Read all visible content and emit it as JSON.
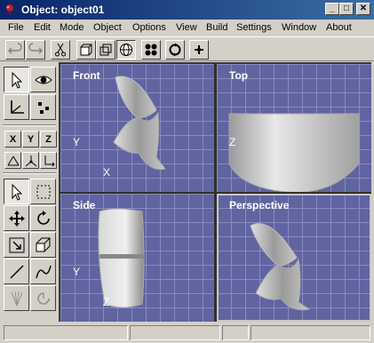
{
  "window": {
    "title": "Object: object01",
    "min_glyph": "_",
    "max_glyph": "□",
    "close_glyph": "✕"
  },
  "menu": [
    {
      "label": "File"
    },
    {
      "label": "Edit"
    },
    {
      "label": "Mode"
    },
    {
      "label": "Object"
    },
    {
      "label": "Options"
    },
    {
      "label": "View"
    },
    {
      "label": "Build"
    },
    {
      "label": "Settings"
    },
    {
      "label": "Window"
    },
    {
      "label": "About"
    }
  ],
  "toolbar": {
    "icons": [
      "undo-icon",
      "redo-icon",
      "cut-icon",
      "solid-box-icon",
      "wireframe-box-icon",
      "sphere-render-icon",
      "points-icon",
      "rotate-view-icon",
      "add-point-icon"
    ]
  },
  "left_panel": {
    "axes": {
      "x": "X",
      "y": "Y",
      "z": "Z"
    }
  },
  "viewports": {
    "front": {
      "label": "Front",
      "axis_v": "Y",
      "axis_h": "X"
    },
    "top": {
      "label": "Top",
      "axis_v": "Z"
    },
    "side": {
      "label": "Side",
      "axis_v": "Y",
      "axis_h": "Z"
    },
    "perspective": {
      "label": "Perspective"
    }
  },
  "colors": {
    "title_gradient_start": "#0a246a",
    "title_gradient_end": "#3a6ea5",
    "viewport_bg": "#6064a0",
    "grid_line": "#8a8cc0",
    "chrome": "#d4d0c8"
  }
}
